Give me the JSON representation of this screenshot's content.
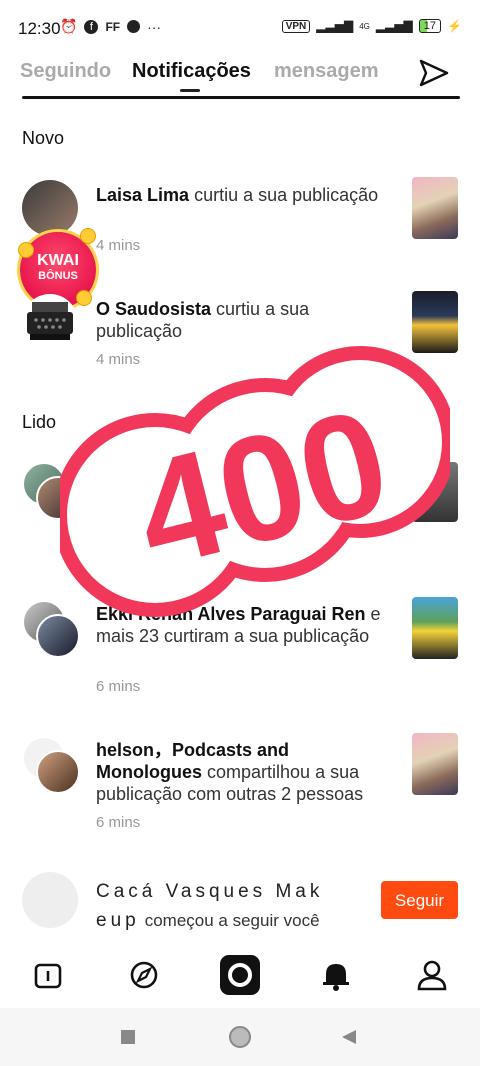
{
  "status_bar": {
    "time": "12:30",
    "icons_left": [
      "alarm-icon",
      "facebook-icon",
      "ff-icon",
      "app-icon",
      "more-icon"
    ],
    "vpn": "VPN",
    "network": "4G",
    "battery": "17"
  },
  "tabs": [
    {
      "label": "Seguindo",
      "active": false
    },
    {
      "label": "Notificações",
      "active": true
    },
    {
      "label": "mensagem",
      "active": false
    }
  ],
  "sections": {
    "new_title": "Novo",
    "read_title": "Lido"
  },
  "notifications": [
    {
      "name": "Laisa Lima",
      "action": "curtiu a sua publicação",
      "time": "4 mins"
    },
    {
      "name": "O Saudosista",
      "action": "curtiu a sua publicação",
      "time": "4 mins"
    },
    {
      "name": "Renan Alves Paraguai Ren",
      "action": "e mais 23 curtiram a sua publicação",
      "time": "6 mins",
      "name_prefix": "Ekkl"
    },
    {
      "name": "helson，Podcasts and Monologues",
      "action": "compartilhou a sua publicação com outras 2 pessoas",
      "time": "6 mins"
    },
    {
      "name": "Cacá Vasques Mak eup",
      "action": "começou a seguir você"
    }
  ],
  "kwai_badge": {
    "line1": "KWAI",
    "line2": "BÔNUS"
  },
  "overlay": {
    "text": "400"
  },
  "follow_button": "Seguir",
  "accent_color": "#ff4b0f"
}
